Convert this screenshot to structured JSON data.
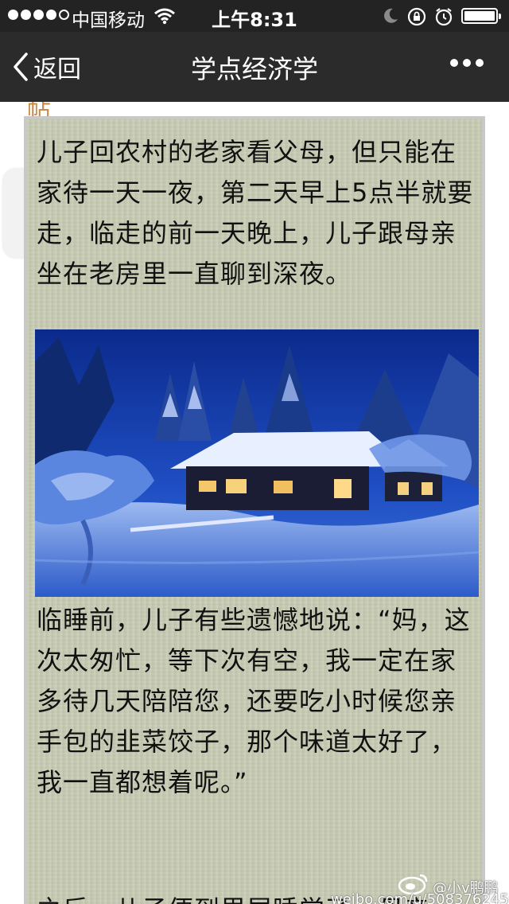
{
  "status_bar": {
    "carrier": "中国移动",
    "time": "上午8:31",
    "signal_bars_filled": 4,
    "signal_bars_total": 5
  },
  "nav": {
    "back_label": "返回",
    "title": "学点经济学",
    "more_icon": "more-dots-icon"
  },
  "article": {
    "top_stub": "帖",
    "paragraph_1": "儿子回农村的老家看父母，但只能在家待一天一夜，第二天早上5点半就要走，临走的前一天晚上，儿子跟母亲坐在老房里一直聊到深夜。",
    "image_icon": "snowy-cabin-photo",
    "paragraph_2": "临睡前，儿子有些遗憾地说：“妈，这次太匆忙，等下次有空，我一定在家多待几天陪陪您，还要吃小时候您亲手包的韭菜饺子，那个味道太好了，我一直都想着呢。”",
    "paragraph_3": "之后，儿子便到里屋睡觉了，母亲"
  },
  "watermark": {
    "user": "@小v鹏鹏",
    "url": "weibo.com/u/5083762459"
  },
  "colors": {
    "status_bar_bg": "#232323",
    "nav_bg": "#2b2b2b",
    "paper_bg": "#c9cdb5",
    "text": "#111111"
  }
}
